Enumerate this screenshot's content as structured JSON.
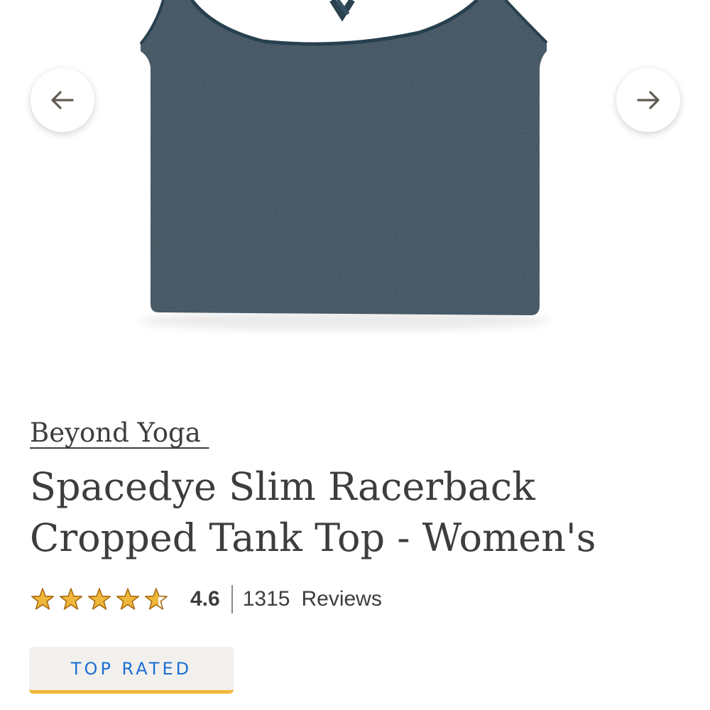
{
  "product": {
    "brand": "Beyond Yoga ",
    "title_line1": "Spacedye Slim Racerback",
    "title_line2": "Cropped Tank Top - Women's",
    "rating": "4.6",
    "rating_fraction": 0.92,
    "review_count": "1315",
    "reviews_label": "Reviews",
    "badge": "TOP RATED"
  },
  "gallery": {
    "prev_icon": "arrow-left-icon",
    "next_icon": "arrow-right-icon",
    "image_subject": "navy heathered cropped tank top"
  },
  "colors": {
    "garment": "#2f4a5a",
    "star_fill": "#f0b83a",
    "star_outline": "#a86b12",
    "badge_text": "#1a6fd4",
    "badge_underline": "#f0b83a"
  }
}
